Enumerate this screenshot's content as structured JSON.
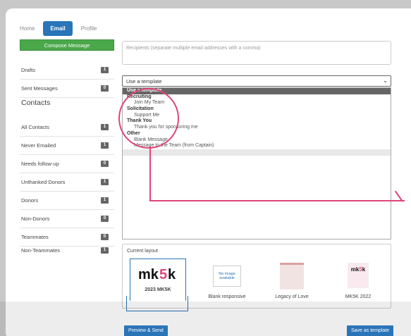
{
  "nav": {
    "tabs": [
      "Home",
      "Email",
      "Profile"
    ],
    "active": "Email"
  },
  "sidebar": {
    "compose_label": "Compose Message",
    "mail_items": [
      {
        "label": "Drafts",
        "count": "1"
      },
      {
        "label": "Sent Messages",
        "count": "0"
      }
    ],
    "contacts_heading": "Contacts",
    "contact_items": [
      {
        "label": "All Contacts",
        "count": "1"
      },
      {
        "label": "Never Emailed",
        "count": "1"
      },
      {
        "label": "Needs follow-up",
        "count": "0"
      },
      {
        "label": "Unthanked Donors",
        "count": "1"
      },
      {
        "label": "Donors",
        "count": "1"
      },
      {
        "label": "Non-Donors",
        "count": "0"
      },
      {
        "label": "Teammates",
        "count": "0"
      },
      {
        "label": "Non-Teammates",
        "count": "1"
      }
    ]
  },
  "compose": {
    "recipients_placeholder": "Recipients (separate multiple email addresses with a comma)",
    "template_select_value": "Use a template",
    "template_options": [
      {
        "type": "selected",
        "label": "Use a template"
      },
      {
        "type": "group",
        "label": "Recruiting"
      },
      {
        "type": "option",
        "label": "Join My Team"
      },
      {
        "type": "group",
        "label": "Solicitation"
      },
      {
        "type": "option",
        "label": "Support Me"
      },
      {
        "type": "group",
        "label": "Thank You"
      },
      {
        "type": "option",
        "label": "Thank you for sponsoring me"
      },
      {
        "type": "group",
        "label": "Other"
      },
      {
        "type": "option",
        "label": "Blank Message"
      },
      {
        "type": "option",
        "label": "Message to the Team (from Captain)"
      }
    ]
  },
  "layout": {
    "label": "Current layout",
    "thumbnails": [
      {
        "caption": "2023 MK5K",
        "logo": "mk5k"
      },
      {
        "caption": "Blank responsive",
        "placeholder": "No image available"
      },
      {
        "caption": "Legacy of Love"
      },
      {
        "caption": "MK5K 2022"
      }
    ]
  },
  "actions": {
    "preview_label": "Preview & Send",
    "save_label": "Save as template"
  },
  "colors": {
    "accent": "#2a74b8",
    "compose": "#4aa84a",
    "annotation": "#e0457b"
  }
}
